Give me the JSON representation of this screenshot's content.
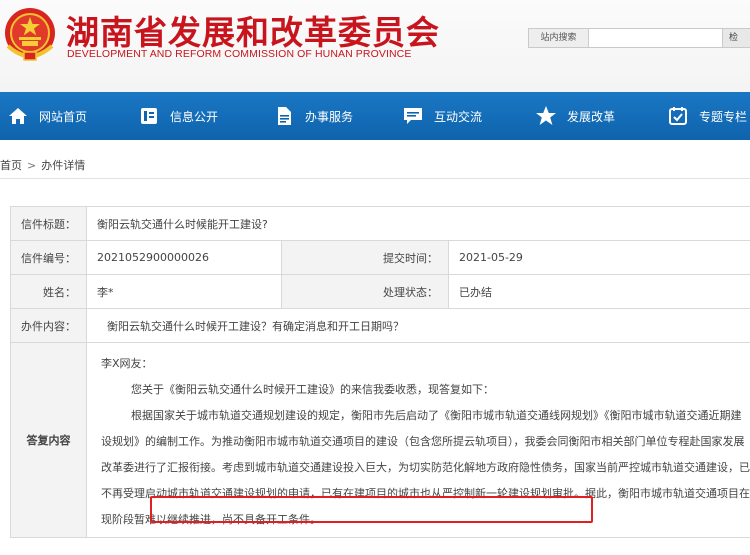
{
  "header": {
    "title": "湖南省发展和改革委员会",
    "subtitle": "DEVELOPMENT AND REFORM COMMISSION OF HUNAN PROVINCE",
    "search_label": "站内搜索",
    "search_placeholder": "",
    "search_button": "检"
  },
  "nav": {
    "items": [
      {
        "label": "网站首页",
        "icon": "home-icon"
      },
      {
        "label": "信息公开",
        "icon": "info-icon"
      },
      {
        "label": "办事服务",
        "icon": "document-icon"
      },
      {
        "label": "互动交流",
        "icon": "chat-icon"
      },
      {
        "label": "发展改革",
        "icon": "star-icon"
      },
      {
        "label": "专题专栏",
        "icon": "calendar-icon"
      }
    ]
  },
  "breadcrumb": {
    "home": "首页",
    "separator": ">",
    "current": "办件详情"
  },
  "details": {
    "title_label": "信件标题：",
    "title_value": "衡阳云轨交通什么时候能开工建设?",
    "number_label": "信件编号：",
    "number_value": "2021052900000026",
    "submit_label": "提交时间：",
    "submit_value": "2021-05-29",
    "name_label": "姓名：",
    "name_value": "李*",
    "status_label": "处理状态：",
    "status_value": "已办结",
    "content_label": "办件内容：",
    "content_value": "衡阳云轨交通什么时候开工建设？有确定消息和开工日期吗？",
    "reply_label": "答复内容"
  },
  "reply": {
    "greeting": "李X网友：",
    "line1": "您关于《衡阳云轨交通什么时候开工建设》的来信我委收悉，现答复如下：",
    "line2": "根据国家关于城市轨道交通规划建设的规定，衡阳市先后启动了《衡阳市城市轨道交通线网规划》《衡阳市城市轨道交通近期建",
    "line3": "设规划》的编制工作。为推动衡阳市城市轨道交通项目的建设（包含您所提云轨项目），我委会同衡阳市相关部门单位专程赴国家发展",
    "line4": "改革委进行了汇报衔接。考虑到城市轨道交通建设投入巨大，为切实防范化解地方政府隐性债务，国家当前严控城市轨道交通建设，已",
    "line5a": "不再受理启动城市轨道交通建设规划的申请，已有在建项目的城市也从严控制新一轮建设规划审批。",
    "line5b": "据此，衡阳市城市轨道交通项目在",
    "line6": "现阶段暂难以继续推进，尚不具备开工条件。"
  },
  "colors": {
    "brand_red": "#c8151d",
    "nav_blue": "#1466b0",
    "highlight_red": "#e02020"
  }
}
